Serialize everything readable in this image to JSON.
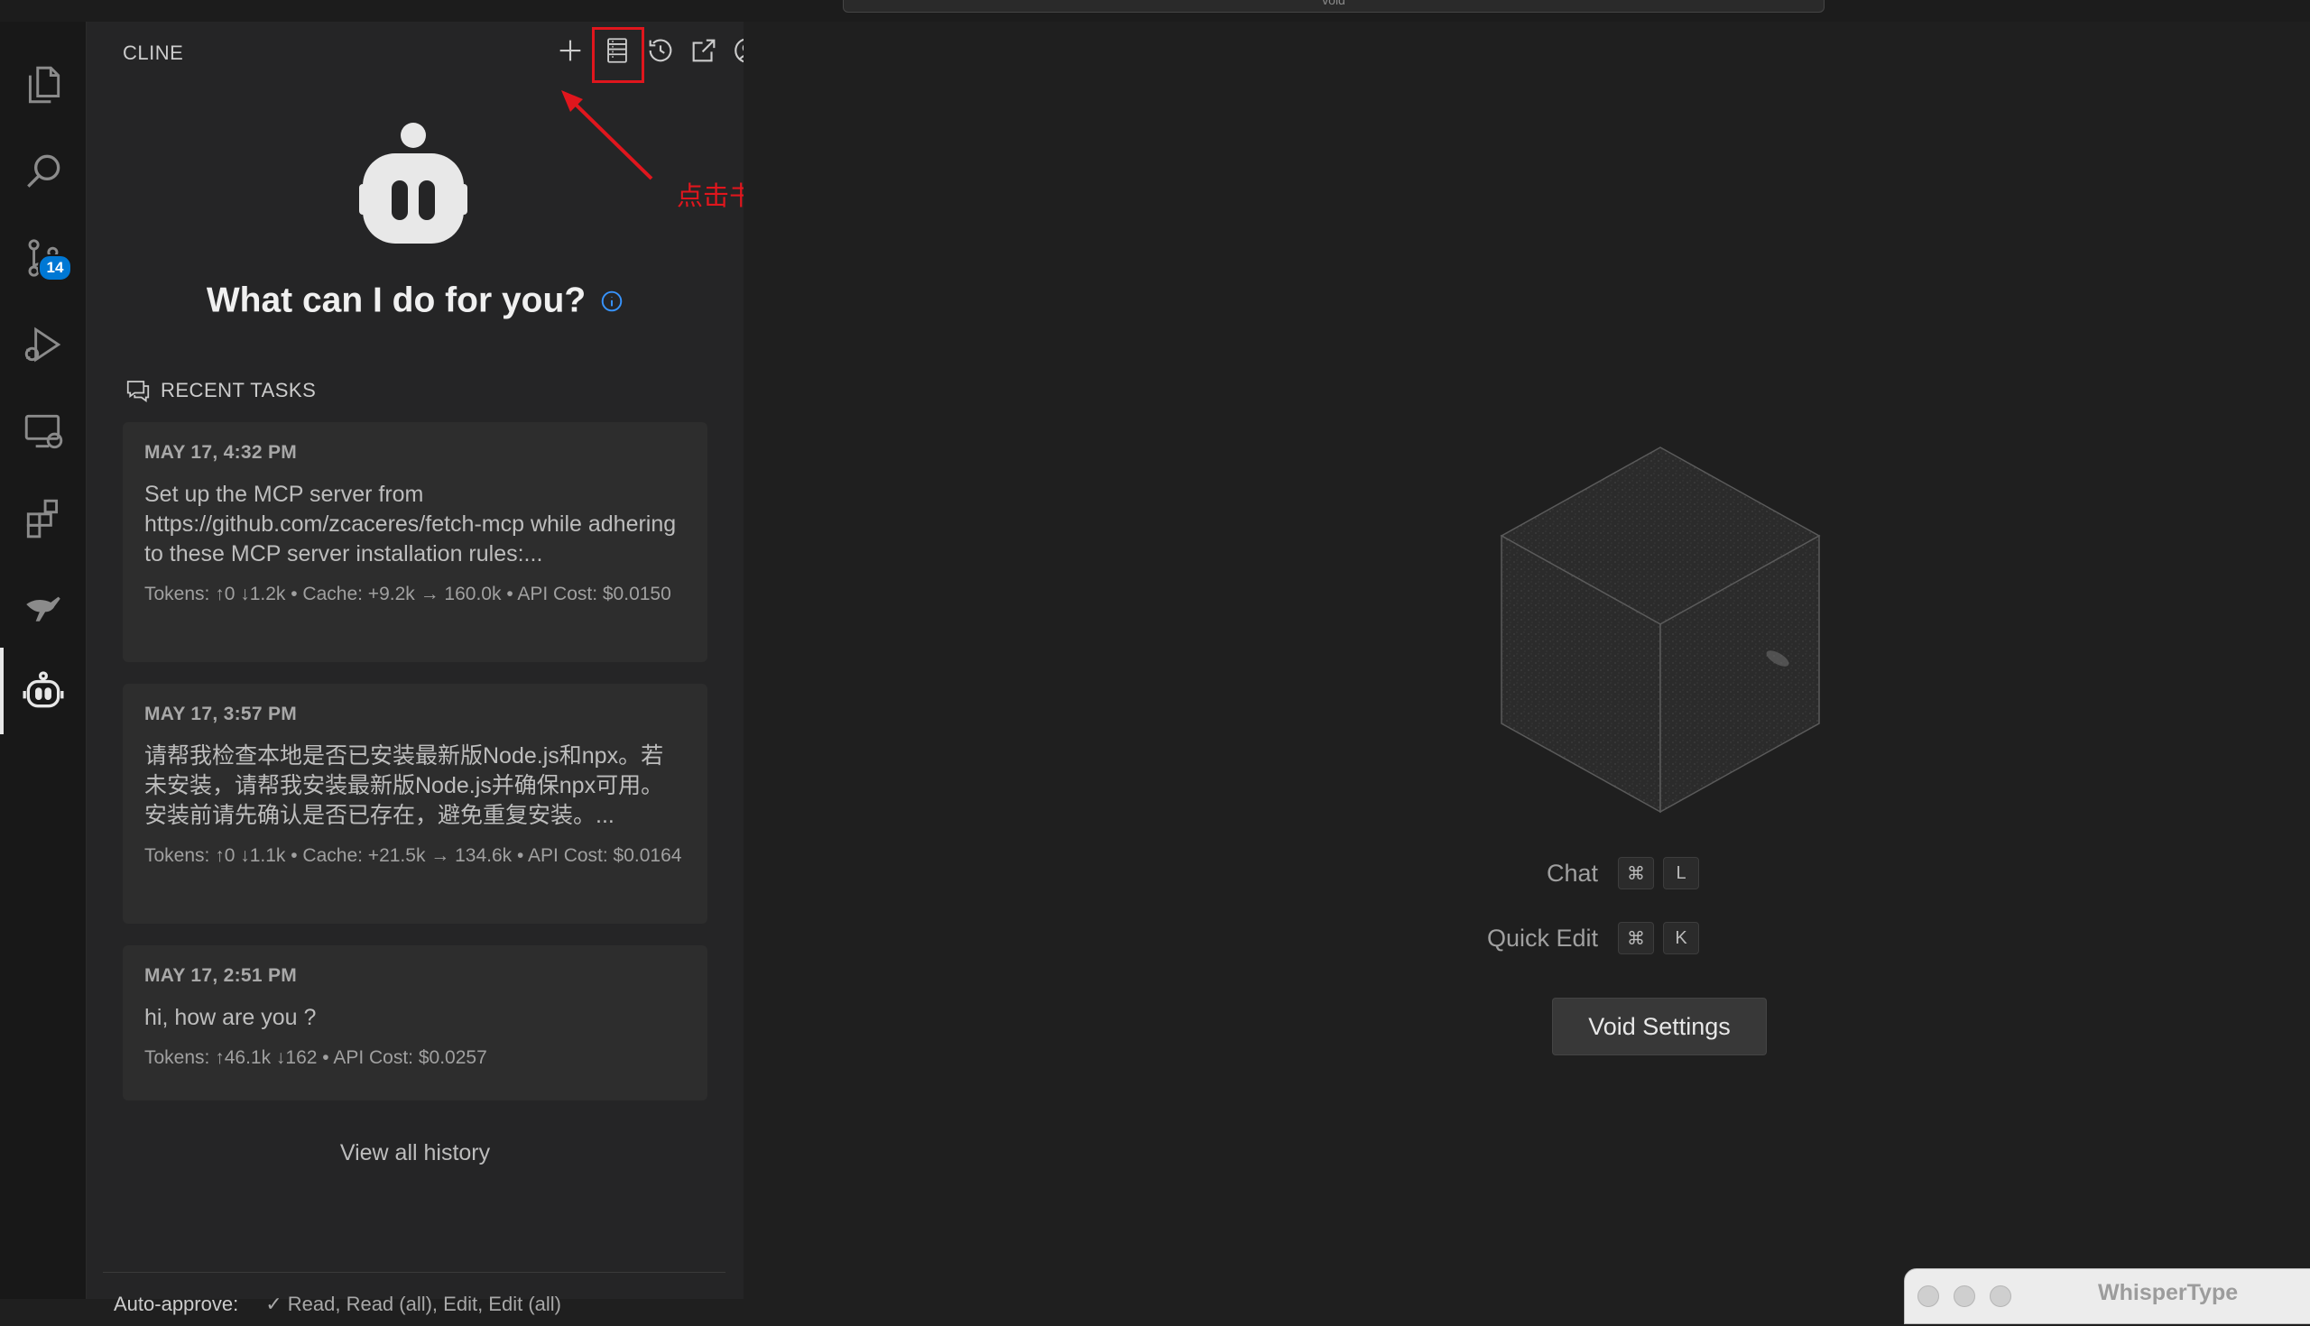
{
  "topbar": {
    "search_text": "void"
  },
  "activity_bar": {
    "items": [
      {
        "name": "explorer-icon"
      },
      {
        "name": "search-icon"
      },
      {
        "name": "source-control-icon",
        "badge": "14"
      },
      {
        "name": "run-debug-icon"
      },
      {
        "name": "remote-explorer-icon"
      },
      {
        "name": "extensions-icon"
      },
      {
        "name": "roo-kangaroo-icon"
      },
      {
        "name": "cline-robot-icon",
        "active": true
      }
    ]
  },
  "sidebar": {
    "title": "CLINE",
    "toolbar": [
      "plus-icon",
      "mcp-servers-icon",
      "history-icon",
      "popout-icon",
      "account-icon",
      "settings-icon"
    ],
    "hero_title": "What can I do for you?",
    "recent_tasks_label": "RECENT TASKS",
    "tasks": [
      {
        "date": "MAY 17, 4:32 PM",
        "text": "Set up the MCP server from https://github.com/zcaceres/fetch-mcp while adhering to these MCP server installation rules:...",
        "meta": "Tokens: ↑0 ↓1.2k • Cache: +9.2k → 160.0k • API Cost: $0.0150"
      },
      {
        "date": "MAY 17, 3:57 PM",
        "text": "请帮我检查本地是否已安装最新版Node.js和npx。若未安装，请帮我安装最新版Node.js并确保npx可用。安装前请先确认是否已存在，避免重复安装。...",
        "meta": "Tokens: ↑0 ↓1.1k • Cache: +21.5k → 134.6k • API Cost: $0.0164"
      },
      {
        "date": "MAY 17, 2:51 PM",
        "text": "hi, how are you ?",
        "meta": "Tokens: ↑46.1k ↓162 • API Cost: $0.0257"
      }
    ],
    "view_all": "View all history",
    "auto_approve_label": "Auto-approve:",
    "auto_approve_options": "✓ Read, Read (all), Edit, Edit (all)"
  },
  "annotation": {
    "text": "点击书架图标进入MCP界面",
    "color": "#e0161d"
  },
  "editor": {
    "shortcuts": [
      {
        "label": "Chat",
        "keys": [
          "⌘",
          "L"
        ]
      },
      {
        "label": "Quick Edit",
        "keys": [
          "⌘",
          "K"
        ]
      }
    ],
    "settings_button": "Void Settings"
  },
  "whisper_window": {
    "title": "WhisperType"
  }
}
